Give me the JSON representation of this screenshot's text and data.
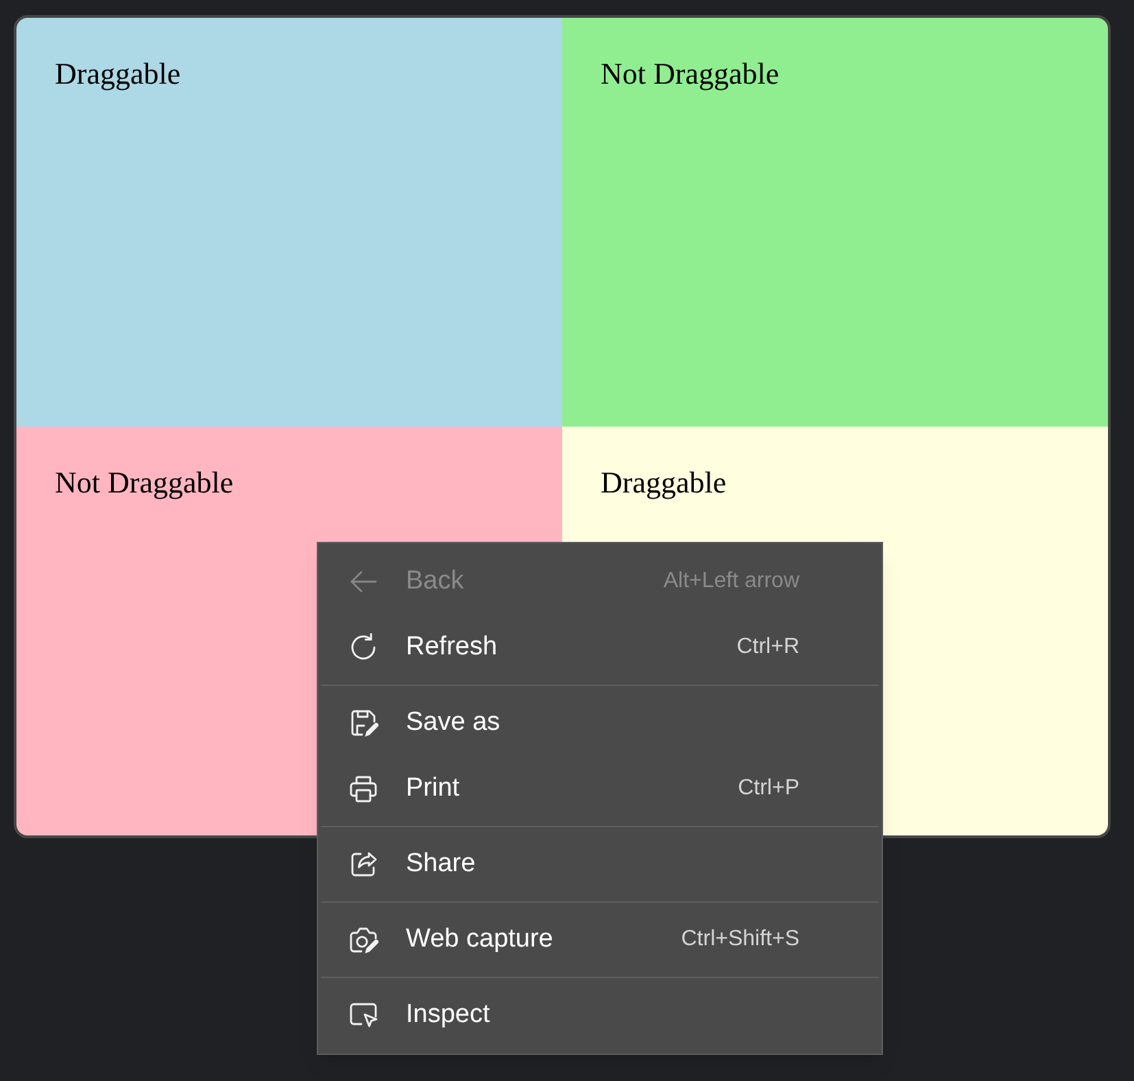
{
  "panels": [
    {
      "label": "Draggable",
      "color": "#add8e6"
    },
    {
      "label": "Not Draggable",
      "color": "#90ee90"
    },
    {
      "label": "Not Draggable",
      "color": "#ffb6c1"
    },
    {
      "label": "Draggable",
      "color": "#ffffe0"
    }
  ],
  "context_menu": {
    "groups": [
      [
        {
          "label": "Back",
          "shortcut": "Alt+Left arrow",
          "disabled": true
        },
        {
          "label": "Refresh",
          "shortcut": "Ctrl+R",
          "disabled": false
        }
      ],
      [
        {
          "label": "Save as",
          "disabled": false
        },
        {
          "label": "Print",
          "shortcut": "Ctrl+P",
          "disabled": false
        }
      ],
      [
        {
          "label": "Share",
          "disabled": false
        }
      ],
      [
        {
          "label": "Web capture",
          "shortcut": "Ctrl+Shift+S",
          "disabled": false
        }
      ],
      [
        {
          "label": "Inspect",
          "disabled": false
        }
      ]
    ]
  }
}
